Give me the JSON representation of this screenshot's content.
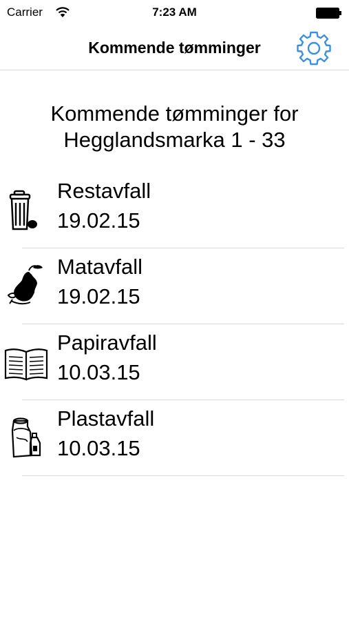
{
  "status_bar": {
    "carrier": "Carrier",
    "time": "7:23 AM"
  },
  "nav": {
    "title": "Kommende tømminger",
    "settings_icon": "gear-icon",
    "accent": "#3a8fe0"
  },
  "heading": {
    "line1": "Kommende tømminger for",
    "line2": "Hegglandsmarka 1 - 33"
  },
  "items": [
    {
      "name": "Restavfall",
      "date": "19.02.15",
      "icon": "trash-can-icon"
    },
    {
      "name": "Matavfall",
      "date": "19.02.15",
      "icon": "apple-core-icon"
    },
    {
      "name": "Papiravfall",
      "date": "10.03.15",
      "icon": "newspaper-icon"
    },
    {
      "name": "Plastavfall",
      "date": "10.03.15",
      "icon": "plastic-bottle-icon"
    }
  ]
}
